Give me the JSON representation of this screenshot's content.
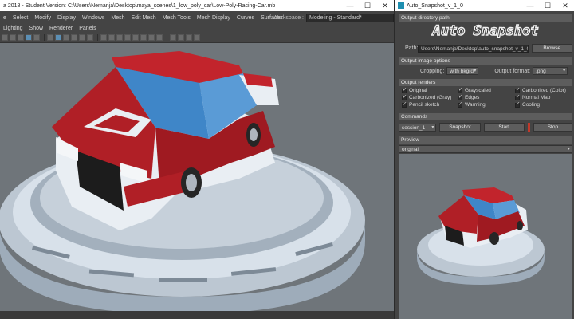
{
  "maya": {
    "title": "a 2018 - Student Version: C:\\Users\\Nemanja\\Desktop\\maya_scenes\\1_low_poly_car\\Low-Poly-Racing-Car.mb",
    "menu": [
      "e",
      "Select",
      "Modify",
      "Display",
      "Windows",
      "Mesh",
      "Edit Mesh",
      "Mesh Tools",
      "Mesh Display",
      "Curves",
      "Surfaces"
    ],
    "workspace_label": "Workspace :",
    "workspace_value": "Modeling - Standard*",
    "view_menu": [
      "Lighting",
      "Show",
      "Renderer",
      "Panels"
    ],
    "window_controls": [
      "—",
      "☐",
      "✕"
    ]
  },
  "snapshot": {
    "title": "Auto_Snapshot_v_1_0",
    "window_controls": [
      "—",
      "☐",
      "✕"
    ],
    "output_directory_header": "Output directory path",
    "logo_text": "Auto Snapshot",
    "path_label": "Path:",
    "path_value": "Users\\Nemanja\\Desktop\\auto_snapshot_v_1_0",
    "browse_label": "Browse",
    "image_options_header": "Output image options",
    "cropping_label": "Cropping:",
    "cropping_value": "with bkgrd",
    "format_label": "Output format:",
    "format_value": ".png",
    "renders_header": "Output renders",
    "renders": [
      "Original",
      "Grayscaled",
      "Carbonized (Color)",
      "Carbonized (Gray)",
      "Edges",
      "Normal Map",
      "Pencil sketch",
      "Warming",
      "Cooling"
    ],
    "commands_header": "Commands",
    "session_value": "session_1",
    "snapshot_label": "Snapshot",
    "start_label": "Start",
    "stop_label": "Stop",
    "preview_header": "Preview",
    "preview_value": "original"
  },
  "colors": {
    "car_red": "#b01f26",
    "car_glass": "#3f86c8",
    "stop_marker": "#c0392b"
  }
}
